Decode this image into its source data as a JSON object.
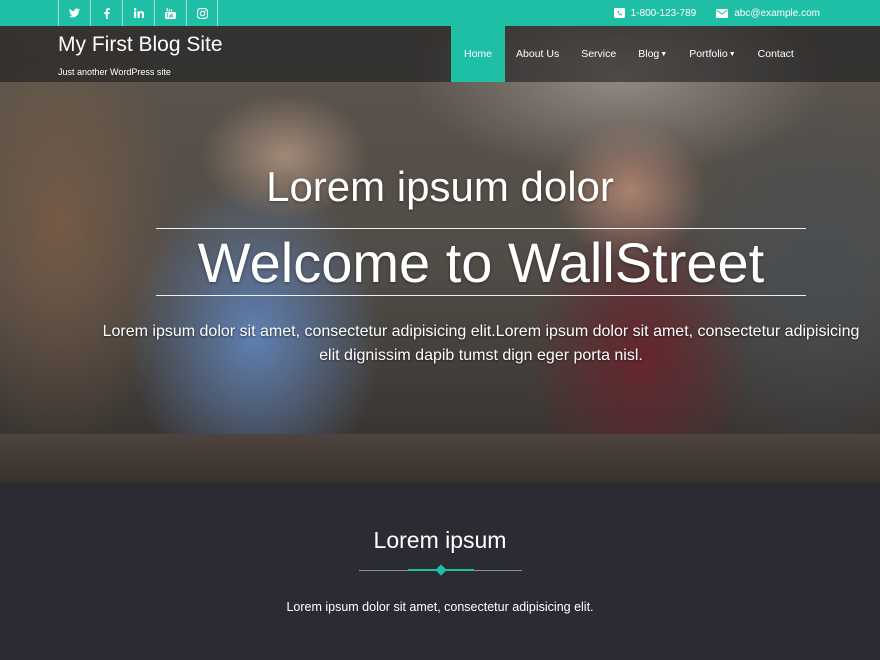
{
  "topbar": {
    "social_icons": [
      "twitter-icon",
      "facebook-icon",
      "linkedin-icon",
      "youtube-icon",
      "instagram-icon"
    ],
    "phone": "1-800-123-789",
    "email": "abc@example.com"
  },
  "header": {
    "site_title": "My First Blog Site",
    "tagline": "Just another WordPress site"
  },
  "nav": {
    "items": [
      {
        "label": "Home",
        "active": true
      },
      {
        "label": "About Us"
      },
      {
        "label": "Service"
      },
      {
        "label": "Blog",
        "dropdown": true
      },
      {
        "label": "Portfolio",
        "dropdown": true
      },
      {
        "label": "Contact"
      }
    ]
  },
  "hero": {
    "subtitle": "Lorem ipsum dolor",
    "title": "Welcome to WallStreet",
    "description": "Lorem ipsum dolor sit amet, consectetur adipisicing elit.Lorem ipsum dolor sit amet, consectetur adipisicing elit dignissim dapib tumst dign eger porta nisl."
  },
  "section": {
    "title": "Lorem ipsum",
    "text": "Lorem ipsum dolor sit amet, consectetur adipisicing elit."
  },
  "colors": {
    "accent": "#1fbfa6",
    "dark_bg": "#2b2c33"
  }
}
